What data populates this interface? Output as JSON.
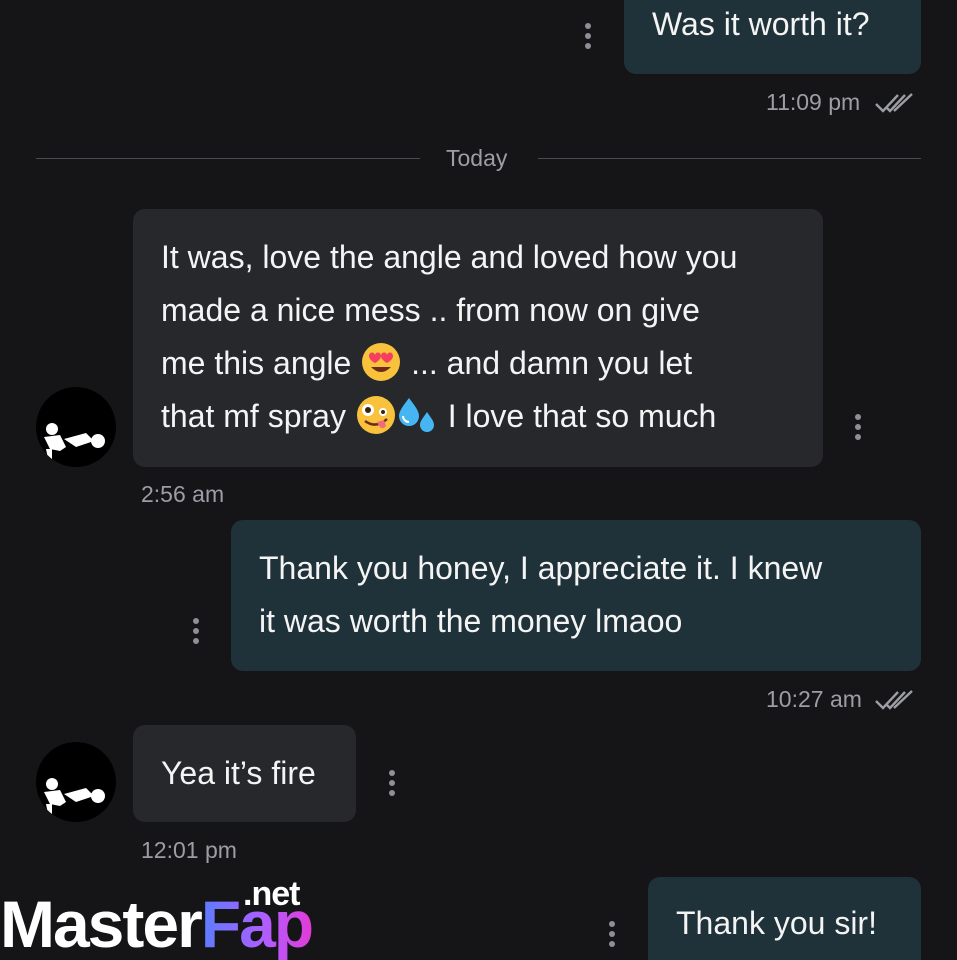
{
  "messages": [
    {
      "direction": "outgoing",
      "lines": [
        "Was it worth it?"
      ],
      "time": "11:09 pm",
      "status": "read-double-check"
    },
    {
      "direction": "incoming",
      "lines": [
        "It was, love the angle and loved how you",
        "made a nice mess .. from now on give",
        "me this angle",
        "... and damn you let",
        "that mf spray",
        "I love that so much"
      ],
      "time": "2:56 am"
    },
    {
      "direction": "outgoing",
      "lines": [
        "Thank you honey, I appreciate it. I knew",
        "it was worth the money lmaoo"
      ],
      "time": "10:27 am",
      "status": "read-double-check"
    },
    {
      "direction": "incoming",
      "lines": [
        "Yea it’s fire"
      ],
      "time": "12:01 pm"
    },
    {
      "direction": "outgoing",
      "lines": [
        "Thank you sir!"
      ]
    }
  ],
  "divider": {
    "label": "Today"
  },
  "emojis": {
    "heart_eyes": "heart-eyes-emoji",
    "zany_face": "zany-face-emoji",
    "sweat_droplets": "sweat-droplets-emoji"
  },
  "watermark": {
    "main": "Master",
    "accent": "Fap",
    "suffix": ".net"
  },
  "colors": {
    "background": "#151518",
    "outgoing_bubble": "#1f3139",
    "incoming_bubble": "#26282c",
    "meta_text": "#9c9ea4"
  }
}
